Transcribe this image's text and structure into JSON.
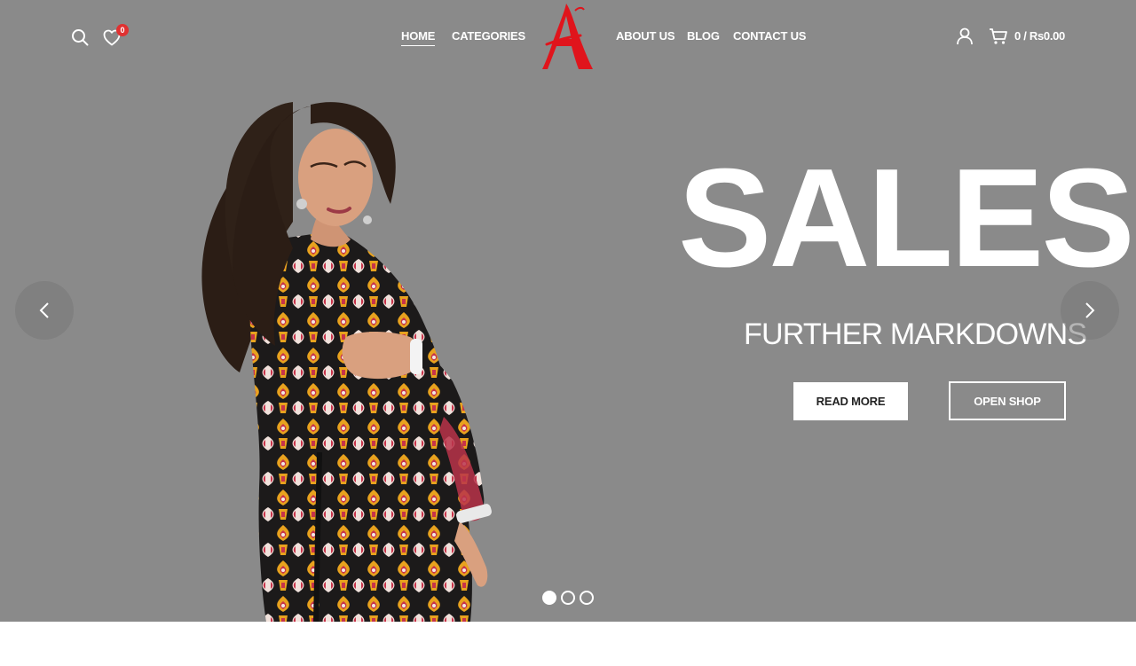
{
  "header": {
    "wishlist_count": "0",
    "nav": [
      {
        "label": "HOME",
        "active": true
      },
      {
        "label": "CATEGORIES",
        "active": false
      },
      {
        "label": "ABOUT US",
        "active": false
      },
      {
        "label": "BLOG",
        "active": false
      },
      {
        "label": "CONTACT US",
        "active": false
      }
    ],
    "logo_letter": "A",
    "cart_total": "0 / Rs0.00"
  },
  "slider": {
    "title": "SALES",
    "subtitle": "FURTHER MARKDOWNS",
    "primary_button": "READ MORE",
    "secondary_button": "OPEN SHOP",
    "slide_count": 3,
    "active_slide": 1
  },
  "icons": {
    "search": "search-icon",
    "wishlist": "heart-icon",
    "account": "user-icon",
    "cart": "cart-icon",
    "prev": "chevron-left-icon",
    "next": "chevron-right-icon"
  },
  "colors": {
    "hero_background": "#8a8a8a",
    "logo_red": "#e0141c",
    "badge_red": "#e03131",
    "text": "#ffffff"
  }
}
